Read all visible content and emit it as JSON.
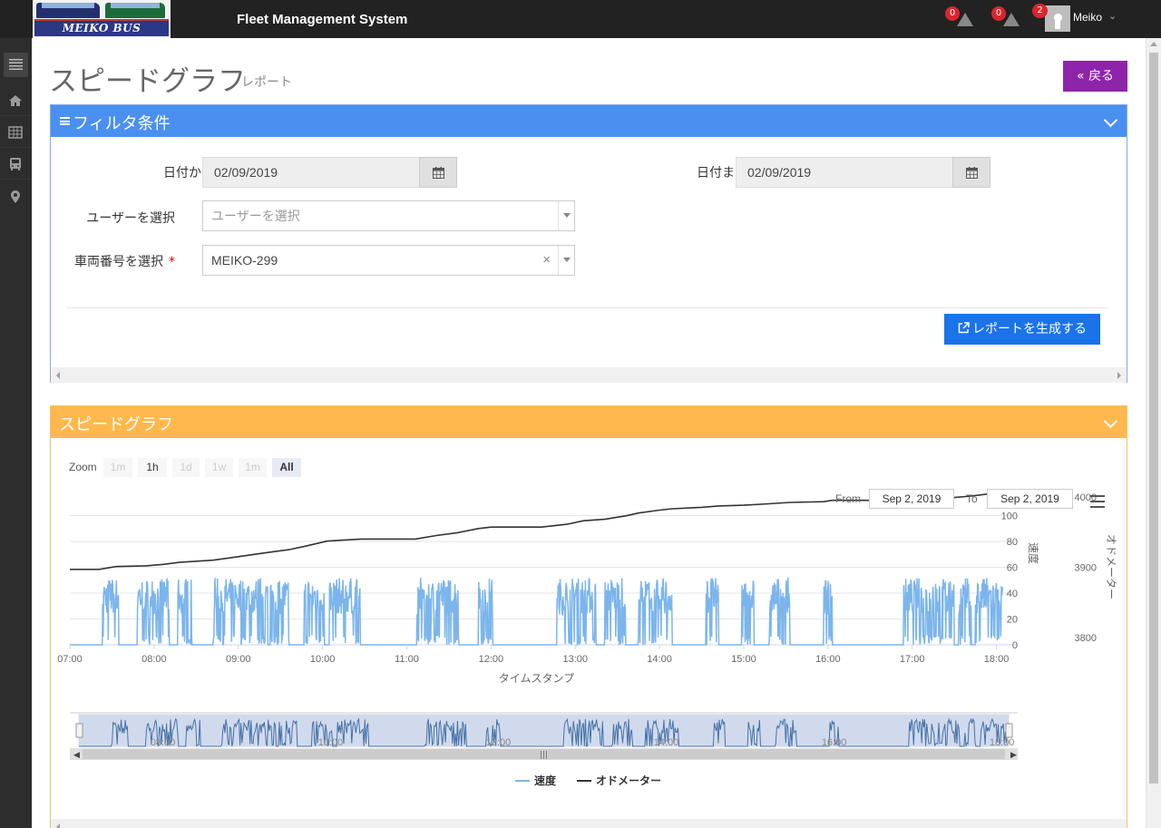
{
  "topbar": {
    "logo_text": "MEIKO BUS",
    "app_title": "Fleet Management System",
    "alerts": [
      {
        "count": "0"
      },
      {
        "count": "0"
      }
    ],
    "user_badge": "2",
    "user_name": "Meiko"
  },
  "page": {
    "title": "スピードグラフ",
    "subtitle": "レポート",
    "back_label": "戻る"
  },
  "filter": {
    "title": "フィルタ条件",
    "date_from_label": "日付から",
    "date_from_value": "02/09/2019",
    "date_to_label": "日付まで",
    "date_to_value": "02/09/2019",
    "user_label": "ユーザーを選択",
    "user_placeholder": "ユーザーを選択",
    "vehicle_label": "車両番号を選択",
    "vehicle_value": "MEIKO-299",
    "required_mark": "*",
    "generate_label": "レポートを生成する"
  },
  "chart_panel": {
    "title": "スピードグラフ"
  },
  "colors": {
    "speed": "#7cb5ec",
    "odometer": "#333333",
    "filter_head": "#4a90f0",
    "chart_head": "#ffb84d",
    "back_btn": "#8e24aa",
    "generate_btn": "#1a73e8"
  },
  "chart_data": {
    "type": "line",
    "zoom_label": "Zoom",
    "zoom_buttons": [
      "1m",
      "1h",
      "1d",
      "1w",
      "1m",
      "All"
    ],
    "zoom_selected": "All",
    "range_from_label": "From",
    "range_from": "Sep 2, 2019",
    "range_to_label": "To",
    "range_to": "Sep 2, 2019",
    "xlabel": "タイムスタンプ",
    "x_ticks": [
      "07:00",
      "08:00",
      "09:00",
      "10:00",
      "11:00",
      "12:00",
      "13:00",
      "14:00",
      "15:00",
      "16:00",
      "17:00",
      "18:00"
    ],
    "x_range": [
      7.0,
      18.08
    ],
    "navigator_ticks": [
      "08:00",
      "10:00",
      "12:00",
      "14:00",
      "16:00",
      "18:00"
    ],
    "y_speed": {
      "label": "速度",
      "ticks": [
        0,
        20,
        40,
        60,
        80,
        100
      ],
      "range": [
        0,
        120
      ]
    },
    "y_odometer": {
      "label": "オドメーター",
      "ticks": [
        3800,
        3900,
        4000
      ],
      "range": [
        3790,
        4010
      ]
    },
    "series": [
      {
        "name": "速度",
        "active_periods": [
          [
            7.38,
            7.58
          ],
          [
            7.8,
            8.18
          ],
          [
            8.28,
            8.45
          ],
          [
            8.7,
            9.35
          ],
          [
            9.38,
            9.6
          ],
          [
            9.78,
            10.02
          ],
          [
            10.08,
            10.45
          ],
          [
            11.12,
            11.62
          ],
          [
            11.85,
            12.02
          ],
          [
            12.78,
            13.25
          ],
          [
            13.35,
            13.6
          ],
          [
            13.75,
            14.15
          ],
          [
            14.55,
            14.7
          ],
          [
            14.98,
            15.12
          ],
          [
            15.3,
            15.55
          ],
          [
            15.95,
            16.05
          ],
          [
            16.9,
            17.5
          ],
          [
            17.55,
            17.7
          ],
          [
            17.75,
            18.08
          ]
        ],
        "peak_max": 52
      },
      {
        "name": "オドメーター",
        "points": [
          [
            7.0,
            3897
          ],
          [
            7.35,
            3897
          ],
          [
            7.55,
            3901
          ],
          [
            7.9,
            3902
          ],
          [
            8.1,
            3904
          ],
          [
            8.3,
            3907
          ],
          [
            8.7,
            3910
          ],
          [
            9.0,
            3915
          ],
          [
            9.35,
            3921
          ],
          [
            9.6,
            3925
          ],
          [
            9.8,
            3930
          ],
          [
            10.05,
            3937
          ],
          [
            10.45,
            3940
          ],
          [
            11.1,
            3940
          ],
          [
            11.35,
            3945
          ],
          [
            11.6,
            3949
          ],
          [
            11.85,
            3955
          ],
          [
            12.0,
            3957
          ],
          [
            12.6,
            3957
          ],
          [
            12.9,
            3961
          ],
          [
            13.1,
            3966
          ],
          [
            13.35,
            3968
          ],
          [
            13.6,
            3973
          ],
          [
            13.75,
            3977
          ],
          [
            14.0,
            3981
          ],
          [
            14.15,
            3983
          ],
          [
            14.5,
            3985
          ],
          [
            14.7,
            3987
          ],
          [
            15.0,
            3988
          ],
          [
            15.3,
            3990
          ],
          [
            15.55,
            3992
          ],
          [
            15.95,
            3993
          ],
          [
            16.05,
            3995
          ],
          [
            16.3,
            3995
          ],
          [
            16.85,
            3995
          ],
          [
            17.5,
            3999
          ],
          [
            17.7,
            4001
          ],
          [
            17.9,
            4004
          ],
          [
            18.08,
            4005
          ]
        ]
      }
    ],
    "legend": [
      "速度",
      "オドメーター"
    ],
    "legend_position": "bottom-center"
  }
}
